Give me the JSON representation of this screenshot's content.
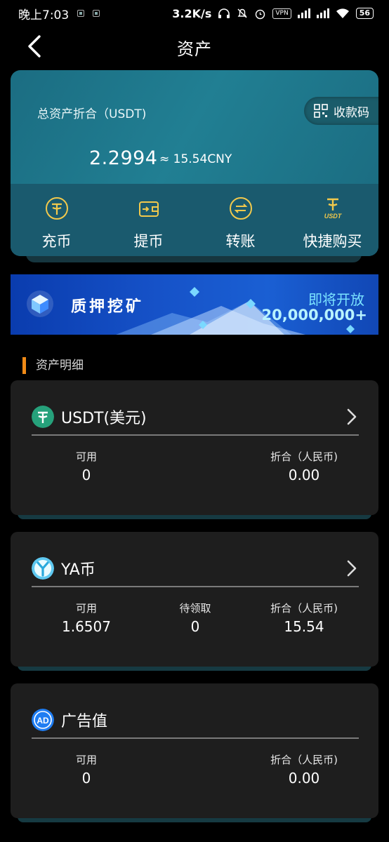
{
  "status_bar": {
    "time": "晚上7:03",
    "net_speed": "3.2K/s",
    "vpn": "VPN",
    "battery": "56"
  },
  "header": {
    "title": "资产"
  },
  "summary": {
    "label": "总资产折合（USDT)",
    "receive_label": "收款码",
    "total": "2.2994",
    "cny": "≈ 15.54CNY"
  },
  "actions": [
    {
      "label": "充币",
      "icon": "tether-icon"
    },
    {
      "label": "提币",
      "icon": "wallet-icon"
    },
    {
      "label": "转账",
      "icon": "transfer-icon"
    },
    {
      "label": "快捷购买",
      "icon": "usdt-logo-icon"
    }
  ],
  "banner": {
    "title": "质押挖矿",
    "subtitle": "即将开放",
    "amount": "20,000,000+"
  },
  "section": {
    "title": "资产明细"
  },
  "assets": [
    {
      "name": "USDT(美元)",
      "icon": "usdt-coin-icon",
      "columns": [
        {
          "label": "可用",
          "value": "0"
        },
        {
          "label": "折合（人民币)",
          "value": "0.00"
        }
      ]
    },
    {
      "name": "YA币",
      "icon": "ya-coin-icon",
      "columns": [
        {
          "label": "可用",
          "value": "1.6507"
        },
        {
          "label": "待领取",
          "value": "0"
        },
        {
          "label": "折合（人民币)",
          "value": "15.54"
        }
      ]
    },
    {
      "name": "广告值",
      "icon": "ad-coin-icon",
      "columns": [
        {
          "label": "可用",
          "value": "0"
        },
        {
          "label": "折合（人民币)",
          "value": "0.00"
        }
      ]
    }
  ],
  "colors": {
    "accent": "#f08a16",
    "card": "#1f7f93",
    "banner": "#1652c8"
  }
}
